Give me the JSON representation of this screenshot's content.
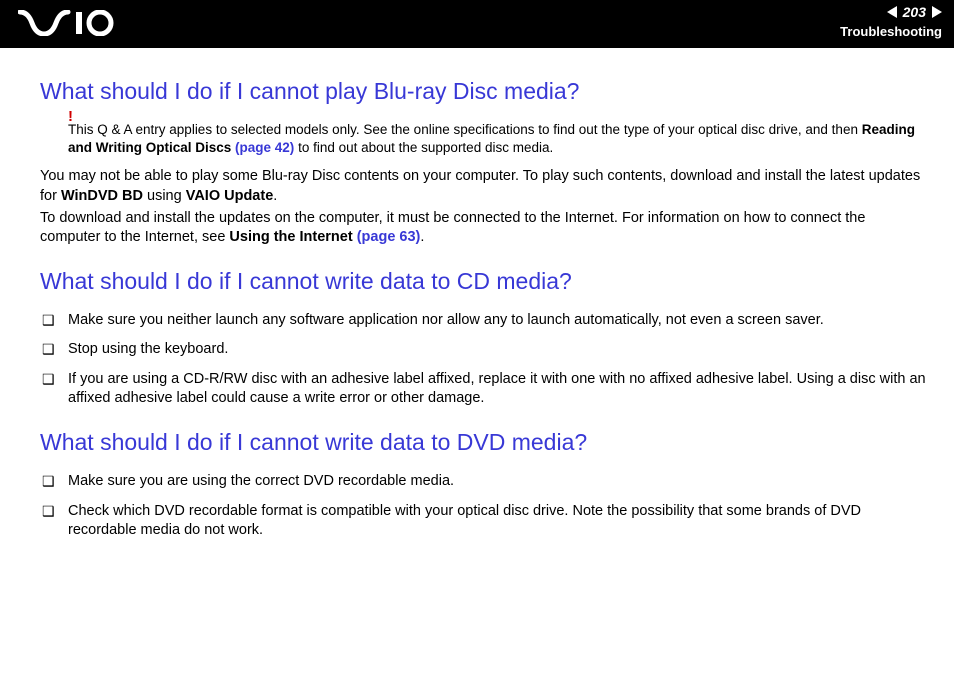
{
  "header": {
    "page_number": "203",
    "section": "Troubleshooting"
  },
  "sections": {
    "bluray": {
      "title": "What should I do if I cannot play Blu-ray Disc media?",
      "note_mark": "!",
      "note_a": "This Q & A entry applies to selected models only. See the online specifications to find out the type of your optical disc drive, and then ",
      "note_bold": "Reading and Writing Optical Discs ",
      "note_link": "(page 42)",
      "note_b": " to find out about the supported disc media.",
      "p1_a": "You may not be able to play some Blu-ray Disc contents on your computer. To play such contents, download and install the latest updates for ",
      "p1_b1": "WinDVD BD",
      "p1_c": " using ",
      "p1_b2": "VAIO Update",
      "p1_d": ".",
      "p2_a": "To download and install the updates on the computer, it must be connected to the Internet. For information on how to connect the computer to the Internet, see ",
      "p2_b": "Using the Internet ",
      "p2_link": "(page 63)",
      "p2_c": "."
    },
    "cd": {
      "title": "What should I do if I cannot write data to CD media?",
      "items": [
        "Make sure you neither launch any software application nor allow any to launch automatically, not even a screen saver.",
        "Stop using the keyboard.",
        "If you are using a CD-R/RW disc with an adhesive label affixed, replace it with one with no affixed adhesive label. Using a disc with an affixed adhesive label could cause a write error or other damage."
      ]
    },
    "dvd": {
      "title": "What should I do if I cannot write data to DVD media?",
      "items": [
        "Make sure you are using the correct DVD recordable media.",
        "Check which DVD recordable format is compatible with your optical disc drive. Note the possibility that some brands of DVD recordable media do not work."
      ]
    }
  }
}
